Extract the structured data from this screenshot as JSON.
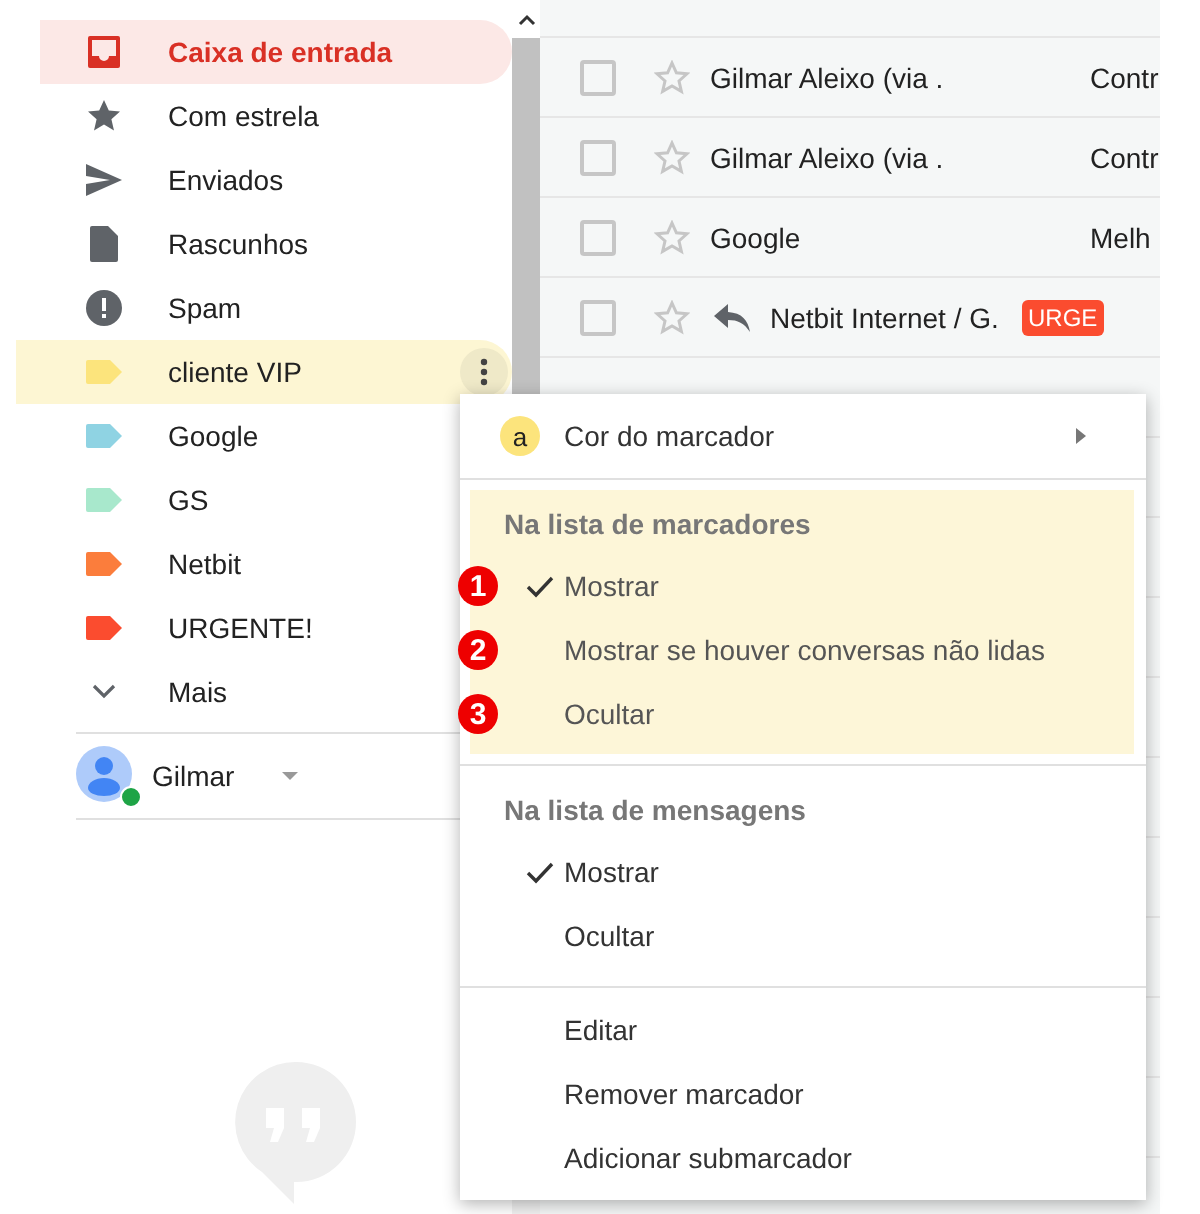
{
  "sidebar": {
    "items": [
      {
        "kind": "folder",
        "label": "Caixa de entrada",
        "selected": true
      },
      {
        "kind": "folder",
        "label": "Com estrela",
        "selected": false
      },
      {
        "kind": "folder",
        "label": "Enviados",
        "selected": false
      },
      {
        "kind": "folder",
        "label": "Rascunhos",
        "selected": false
      },
      {
        "kind": "folder",
        "label": "Spam",
        "selected": false
      },
      {
        "kind": "label",
        "label": "cliente VIP",
        "color": "#fce47c",
        "selected": false,
        "highlighted": true
      },
      {
        "kind": "label",
        "label": "Google",
        "color": "#8fd3e3",
        "selected": false,
        "highlighted": false
      },
      {
        "kind": "label",
        "label": "GS",
        "color": "#a8e8cc",
        "selected": false,
        "highlighted": false
      },
      {
        "kind": "label",
        "label": "Netbit",
        "color": "#fb7d3c",
        "selected": false,
        "highlighted": false
      },
      {
        "kind": "label",
        "label": "URGENTE!",
        "color": "#fb4c2f",
        "selected": false,
        "highlighted": false
      },
      {
        "kind": "more",
        "label": "Mais",
        "selected": false
      }
    ],
    "account": {
      "name": "Gilmar",
      "online": true
    }
  },
  "messages": [
    {
      "sender": "Gilmar Aleixo (via .",
      "subject": "Contr",
      "replied": false,
      "checked": false
    },
    {
      "sender": "Gilmar Aleixo (via .",
      "subject": "Contr",
      "replied": false,
      "checked": false
    },
    {
      "sender": "Google",
      "subject": "Melh",
      "replied": false,
      "checked": false
    },
    {
      "sender": "Netbit Internet / G.",
      "chip": {
        "text": "URGE",
        "color": "#fb4c2f"
      },
      "replied": true,
      "checked": false
    }
  ],
  "menu": {
    "color_item": {
      "badge": "a",
      "label": "Cor do marcador"
    },
    "sections": [
      {
        "heading": "Na lista de marcadores",
        "highlighted": true,
        "options": [
          {
            "marker": "1",
            "label": "Mostrar",
            "checked": true
          },
          {
            "marker": "2",
            "label": "Mostrar se houver conversas não lidas",
            "checked": false
          },
          {
            "marker": "3",
            "label": "Ocultar",
            "checked": false
          }
        ]
      },
      {
        "heading": "Na lista de mensagens",
        "highlighted": false,
        "options": [
          {
            "label": "Mostrar",
            "checked": true
          },
          {
            "label": "Ocultar",
            "checked": false
          }
        ]
      }
    ],
    "actions": [
      "Editar",
      "Remover marcador",
      "Adicionar submarcador"
    ]
  }
}
